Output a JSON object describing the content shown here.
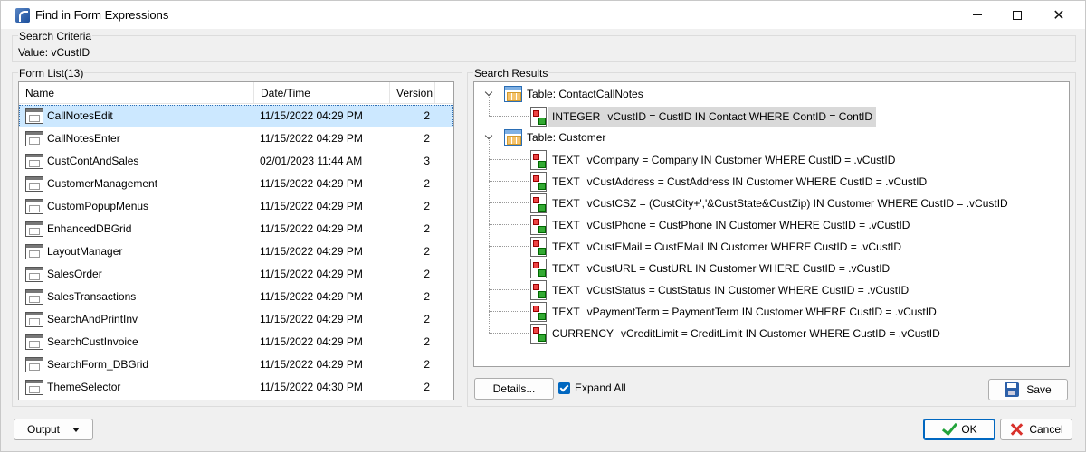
{
  "window": {
    "title": "Find in Form Expressions"
  },
  "search_criteria": {
    "label": "Search Criteria",
    "value_text": "Value: vCustID"
  },
  "form_list": {
    "label": "Form List(13)",
    "columns": [
      "Name",
      "Date/Time",
      "Version"
    ],
    "rows": [
      {
        "name": "CallNotesEdit",
        "date": "11/15/2022 04:29 PM",
        "version": "2"
      },
      {
        "name": "CallNotesEnter",
        "date": "11/15/2022 04:29 PM",
        "version": "2"
      },
      {
        "name": "CustContAndSales",
        "date": "02/01/2023 11:44 AM",
        "version": "3"
      },
      {
        "name": "CustomerManagement",
        "date": "11/15/2022 04:29 PM",
        "version": "2"
      },
      {
        "name": "CustomPopupMenus",
        "date": "11/15/2022 04:29 PM",
        "version": "2"
      },
      {
        "name": "EnhancedDBGrid",
        "date": "11/15/2022 04:29 PM",
        "version": "2"
      },
      {
        "name": "LayoutManager",
        "date": "11/15/2022 04:29 PM",
        "version": "2"
      },
      {
        "name": "SalesOrder",
        "date": "11/15/2022 04:29 PM",
        "version": "2"
      },
      {
        "name": "SalesTransactions",
        "date": "11/15/2022 04:29 PM",
        "version": "2"
      },
      {
        "name": "SearchAndPrintInv",
        "date": "11/15/2022 04:29 PM",
        "version": "2"
      },
      {
        "name": "SearchCustInvoice",
        "date": "11/15/2022 04:29 PM",
        "version": "2"
      },
      {
        "name": "SearchForm_DBGrid",
        "date": "11/15/2022 04:29 PM",
        "version": "2"
      },
      {
        "name": "ThemeSelector",
        "date": "11/15/2022 04:30 PM",
        "version": "2"
      }
    ]
  },
  "search_results": {
    "label": "Search Results",
    "tables": [
      {
        "label": "Table: ContactCallNotes",
        "items": [
          {
            "type": "INTEGER",
            "expr": "vCustID = CustID IN Contact WHERE ContID = ContID"
          }
        ]
      },
      {
        "label": "Table: Customer",
        "items": [
          {
            "type": "TEXT",
            "expr": "vCompany = Company IN Customer WHERE CustID = .vCustID"
          },
          {
            "type": "TEXT",
            "expr": "vCustAddress = CustAddress IN Customer WHERE CustID = .vCustID"
          },
          {
            "type": "TEXT",
            "expr": "vCustCSZ = (CustCity+','&CustState&CustZip) IN Customer WHERE CustID = .vCustID"
          },
          {
            "type": "TEXT",
            "expr": "vCustPhone = CustPhone IN Customer WHERE CustID = .vCustID"
          },
          {
            "type": "TEXT",
            "expr": "vCustEMail = CustEMail IN Customer WHERE CustID = .vCustID"
          },
          {
            "type": "TEXT",
            "expr": "vCustURL = CustURL IN Customer WHERE CustID = .vCustID"
          },
          {
            "type": "TEXT",
            "expr": "vCustStatus = CustStatus IN Customer WHERE CustID = .vCustID"
          },
          {
            "type": "TEXT",
            "expr": "vPaymentTerm = PaymentTerm IN Customer WHERE CustID = .vCustID"
          },
          {
            "type": "CURRENCY",
            "expr": "vCreditLimit = CreditLimit IN Customer WHERE CustID = .vCustID"
          }
        ]
      }
    ]
  },
  "buttons": {
    "details": "Details...",
    "expand_all": "Expand All",
    "save": "Save",
    "output": "Output",
    "ok": "OK",
    "cancel": "Cancel"
  },
  "colors": {
    "selection": "#cce8ff",
    "accent": "#0067c0"
  }
}
